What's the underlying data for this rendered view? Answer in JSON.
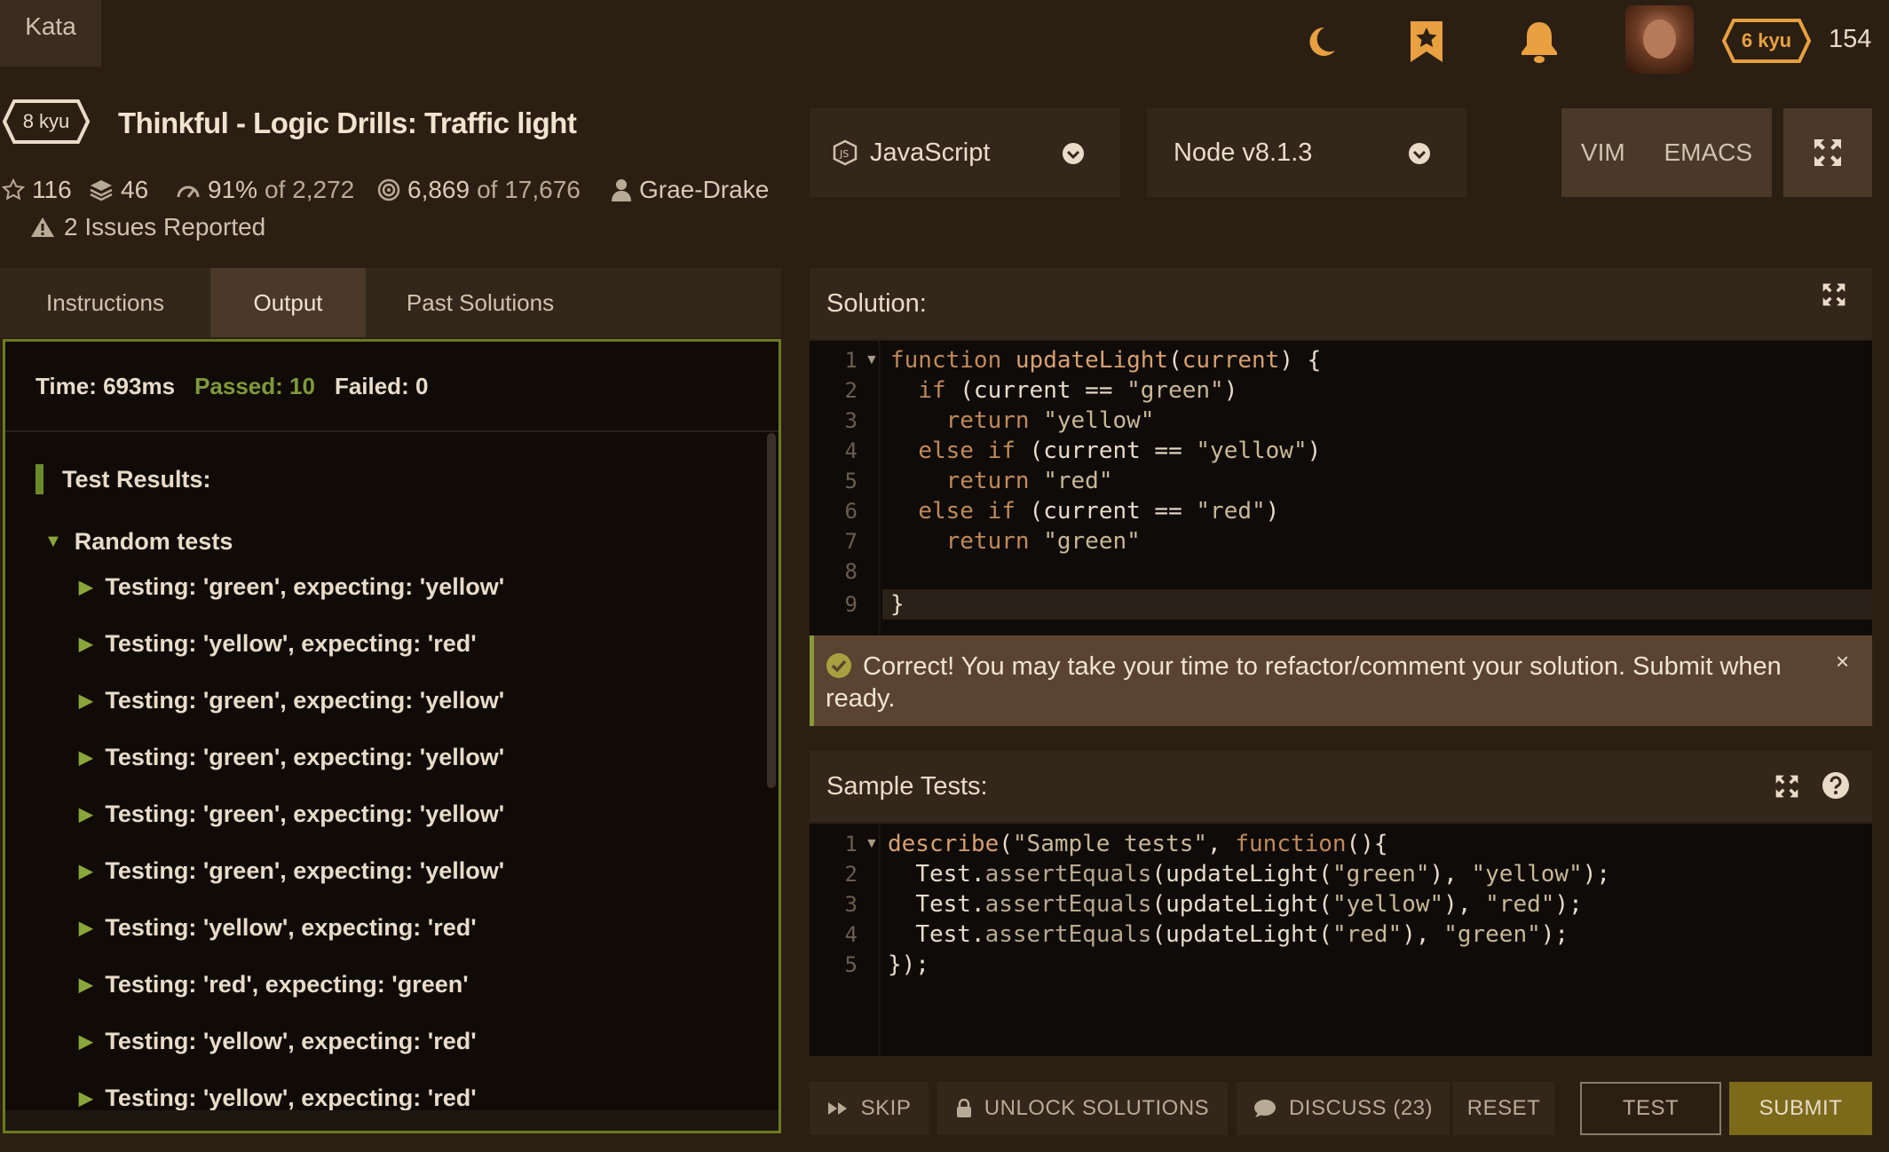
{
  "nav": {
    "kata_tab": "Kata",
    "user_rank": "6 kyu",
    "honor": "154"
  },
  "kata": {
    "rank": "8 kyu",
    "title": "Thinkful - Logic Drills: Traffic light",
    "stars": "116",
    "collections": "46",
    "satisfaction_pct": "91%",
    "satisfaction_of": "of 2,272",
    "completed": "6,869",
    "completed_of": "of 17,676",
    "author": "Grae-Drake",
    "issues": "2 Issues Reported"
  },
  "selects": {
    "language": "JavaScript",
    "version": "Node v8.1.3"
  },
  "editor_modes": {
    "vim": "VIM",
    "emacs": "EMACS"
  },
  "tabs": {
    "instructions": "Instructions",
    "output": "Output",
    "past_solutions": "Past Solutions"
  },
  "output": {
    "time": "Time: 693ms",
    "passed": "Passed: 10",
    "failed": "Failed: 0",
    "results_header": "Test Results:",
    "group": "Random tests",
    "tests": [
      "Testing: 'green', expecting: 'yellow'",
      "Testing: 'yellow', expecting: 'red'",
      "Testing: 'green', expecting: 'yellow'",
      "Testing: 'green', expecting: 'yellow'",
      "Testing: 'green', expecting: 'yellow'",
      "Testing: 'green', expecting: 'yellow'",
      "Testing: 'yellow', expecting: 'red'",
      "Testing: 'red', expecting: 'green'",
      "Testing: 'yellow', expecting: 'red'",
      "Testing: 'yellow', expecting: 'red'"
    ]
  },
  "solution": {
    "label": "Solution:",
    "line_numbers": [
      "1",
      "2",
      "3",
      "4",
      "5",
      "6",
      "7",
      "8",
      "9"
    ]
  },
  "notice": {
    "text": "Correct! You may take your time to refactor/comment your solution. Submit when ready.",
    "close": "×"
  },
  "sample_tests": {
    "label": "Sample Tests:",
    "line_numbers": [
      "1",
      "2",
      "3",
      "4",
      "5"
    ]
  },
  "actions": {
    "skip": "SKIP",
    "unlock": "UNLOCK SOLUTIONS",
    "discuss": "DISCUSS (23)",
    "reset": "RESET",
    "test": "TEST",
    "submit": "SUBMIT"
  },
  "colors": {
    "background": "#2b1f14",
    "panel": "#33261a",
    "accent_orange": "#e89a3a",
    "passed_green": "#7f9a3a",
    "submit_olive": "#7a6a1a"
  }
}
